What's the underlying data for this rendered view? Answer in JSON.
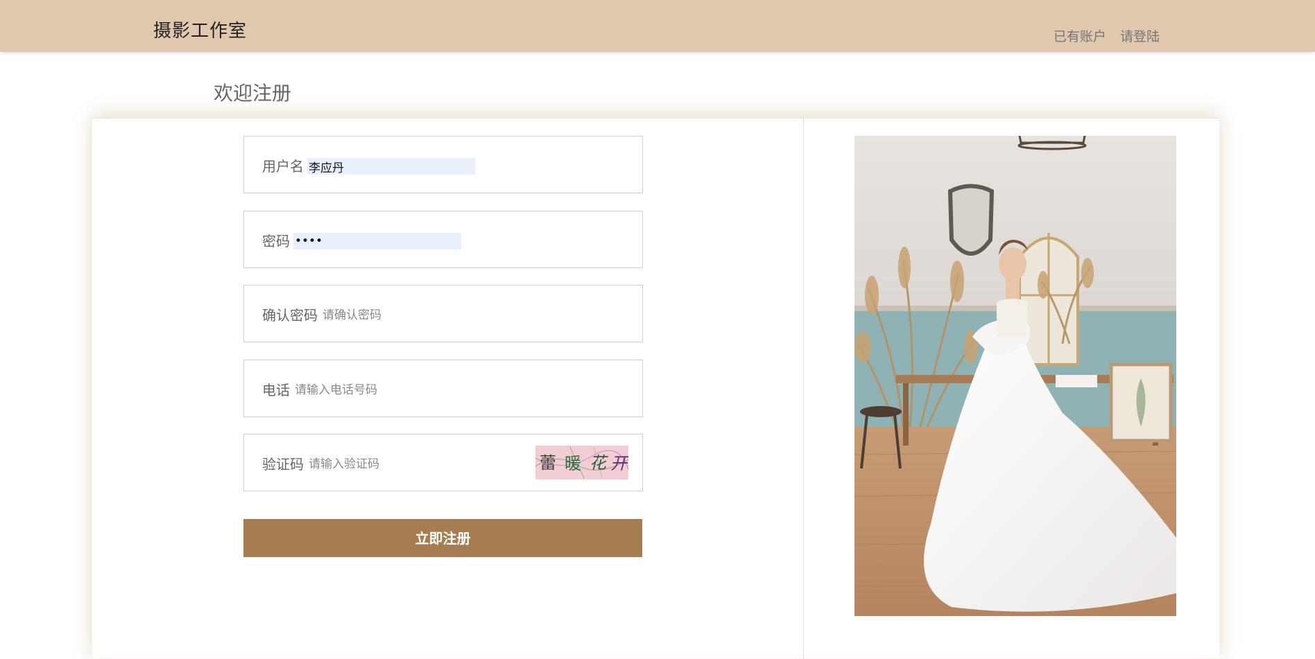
{
  "header": {
    "brand": "摄影工作室",
    "have_account": "已有账户",
    "login": "请登陆"
  },
  "page": {
    "title": "欢迎注册"
  },
  "form": {
    "username": {
      "label": "用户名",
      "value": "李应丹",
      "placeholder": ""
    },
    "password": {
      "label": "密码",
      "value": "••••",
      "placeholder": ""
    },
    "confirm": {
      "label": "确认密码",
      "value": "",
      "placeholder": "请确认密码"
    },
    "phone": {
      "label": "电话",
      "value": "",
      "placeholder": "请输入电话号码"
    },
    "captcha": {
      "label": "验证码",
      "value": "",
      "placeholder": "请输入验证码",
      "image_text": "蕾 暖 花 开"
    },
    "submit_label": "立即注册"
  },
  "colors": {
    "header_bg": "#e0c8ae",
    "button_bg": "#a57d50",
    "autofill_bg": "#e8f0fe"
  },
  "icons": {
    "photo": "wedding-photo"
  }
}
